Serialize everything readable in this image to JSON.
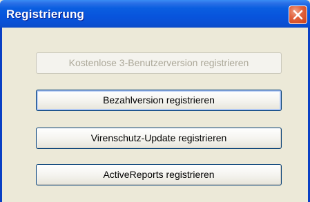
{
  "window": {
    "title": "Registrierung",
    "close_icon": "close-icon"
  },
  "buttons": {
    "free_version": "Kostenlose 3-Benutzerversion registrieren",
    "paid_version": "Bezahlversion registrieren",
    "antivirus_update": "Virenschutz-Update registrieren",
    "activereports": "ActiveReports registrieren"
  },
  "states": {
    "free_version_enabled": false,
    "default_button": "paid_version"
  },
  "colors": {
    "titlebar": "#0a5ee0",
    "close_button": "#e2643f",
    "dialog_background": "#ece9d8"
  }
}
